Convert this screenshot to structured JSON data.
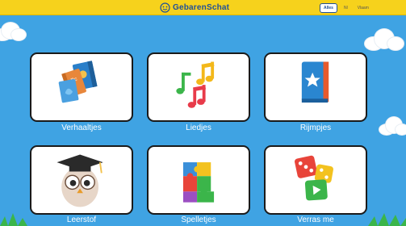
{
  "header": {
    "app_name": "GebarenSchat",
    "languages": [
      {
        "label": "Alles",
        "active": true
      },
      {
        "label": "Nl",
        "active": false
      },
      {
        "label": "Vlaam",
        "active": false
      }
    ]
  },
  "tiles": [
    {
      "label": "Verhaaltjes",
      "icon": "books-icon"
    },
    {
      "label": "Liedjes",
      "icon": "music-notes-icon"
    },
    {
      "label": "Rijmpjes",
      "icon": "star-book-icon"
    },
    {
      "label": "Leerstof",
      "icon": "graduation-owl-icon"
    },
    {
      "label": "Spelletjes",
      "icon": "puzzle-icon"
    },
    {
      "label": "Verras me",
      "icon": "dice-icon"
    }
  ],
  "colors": {
    "background": "#3fa3e3",
    "topbar": "#f6d21c",
    "tile_border": "#1a1a1a",
    "brand": "#1e4f9a"
  }
}
